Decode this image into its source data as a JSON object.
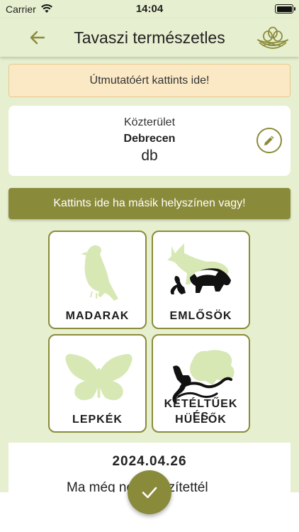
{
  "status_bar": {
    "carrier": "Carrier",
    "time": "14:04"
  },
  "nav": {
    "title": "Tavaszi természetles",
    "back_icon": "arrow-left-icon",
    "logo_icon": "nest-icon"
  },
  "guide_banner": {
    "label": "Útmutatóért kattints ide!"
  },
  "location": {
    "type_label": "Közterület",
    "city": "Debrecen",
    "count": "db",
    "edit_icon": "pencil-icon"
  },
  "other_location_button": {
    "label": "Kattints ide ha másik helyszínen vagy!"
  },
  "categories": [
    {
      "label": "MADARAK",
      "icon": "bird-icon"
    },
    {
      "label": "EMLŐSÖK",
      "icon": "mammals-icon"
    },
    {
      "label": "LEPKÉK",
      "icon": "butterfly-icon"
    },
    {
      "label_line1": "KÉTÉLTŰEK ÉS",
      "label_line2": "HÜLLŐK",
      "icon": "frog-lizard-icon"
    }
  ],
  "date_card": {
    "date": "2024.04.26",
    "today_text": "Ma még nem rögzítettél"
  },
  "fab": {
    "icon": "checkmark-icon"
  },
  "colors": {
    "background": "#e6efcf",
    "accent": "#8a8b3a",
    "banner": "#fbe9c6",
    "silhouette": "#d7e8b5"
  }
}
